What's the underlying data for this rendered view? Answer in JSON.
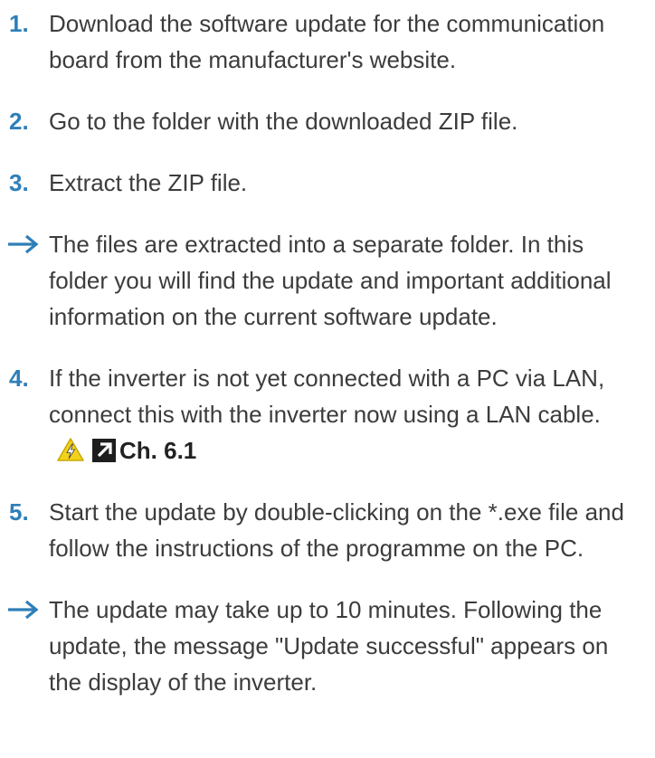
{
  "steps": [
    {
      "marker": "1.",
      "text": "Download the software update for the communication board from the manufacturer's website."
    },
    {
      "marker": "2.",
      "text": "Go to the folder with the downloaded ZIP file."
    },
    {
      "marker": "3.",
      "text": "Extract the ZIP file."
    }
  ],
  "result1": {
    "text": "The files are extracted into a separate folder. In this folder you will find the update and important additional information on the current software update."
  },
  "step4": {
    "marker": "4.",
    "text": "If the inverter is not yet connected with a PC via LAN, connect this with the inverter now using a LAN cable.",
    "ref": "Ch. 6.1"
  },
  "step5": {
    "marker": "5.",
    "text": "Start the update by double-clicking on the *.exe file and follow the instructions of the programme on the PC."
  },
  "result2": {
    "text": "The update may take up to 10 minutes. Following the update, the message \"Update successful\" appears on the display of the inverter."
  },
  "colors": {
    "marker": "#2e7fb8",
    "text": "#3c3c3c",
    "warning": "#f2d21b"
  },
  "icons": [
    "arrow-right-icon",
    "warning-triangle-icon",
    "cross-reference-icon"
  ]
}
